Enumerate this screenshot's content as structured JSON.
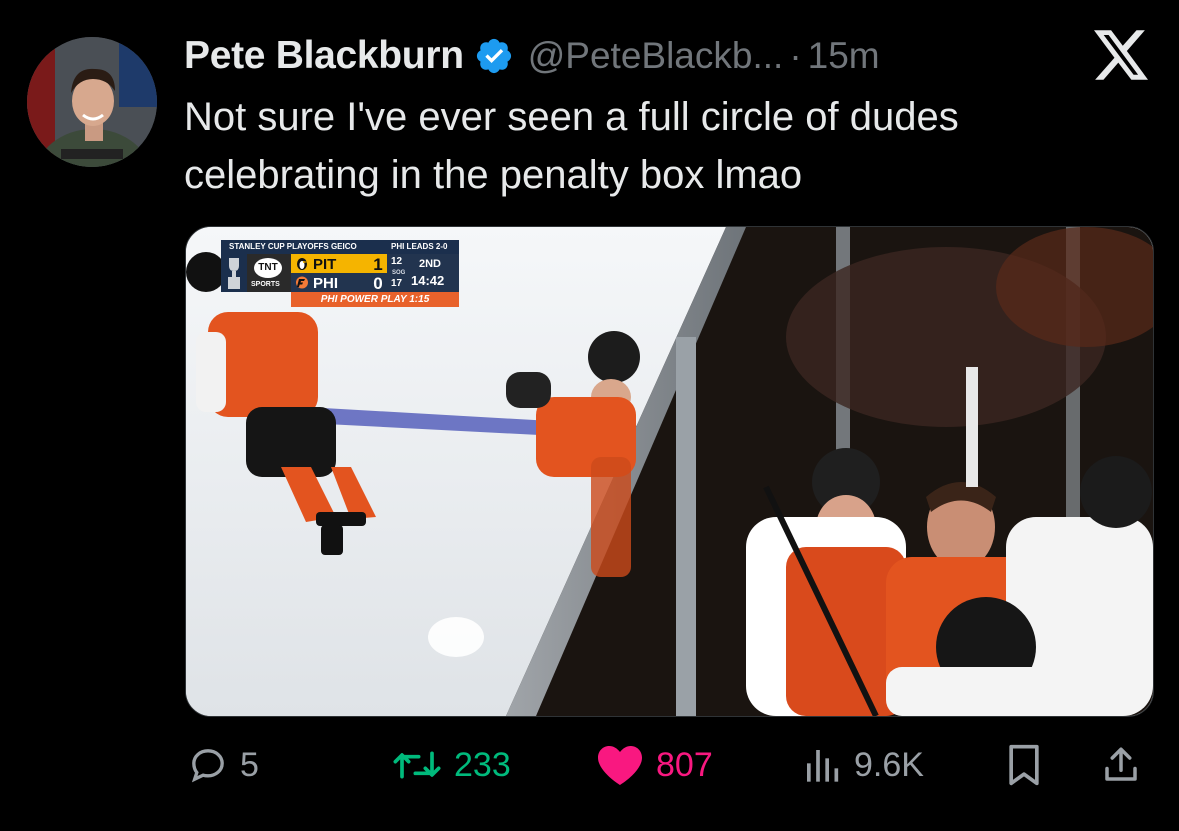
{
  "author": {
    "name": "Pete Blackburn",
    "handle": "@PeteBlackb...",
    "separator": "·",
    "time": "15m",
    "verified": true,
    "avatar_icon": "profile-photo"
  },
  "platform_icon": "x-logo-icon",
  "tweet": {
    "text": "Not sure I've ever seen a full circle of dudes celebrating in the penalty box lmao"
  },
  "media": {
    "scorebug": {
      "header_left": "STANLEY CUP PLAYOFFS GEICO",
      "header_right": "PHI LEADS 2-0",
      "network": "TNT",
      "network_sub": "SPORTS",
      "teams": [
        {
          "abbr": "PIT",
          "score": "1",
          "sog": "12"
        },
        {
          "abbr": "PHI",
          "score": "0",
          "sog": "17"
        }
      ],
      "sog_label": "SOG",
      "period": "2ND",
      "clock": "14:42",
      "power_play": "PHI POWER PLAY 1:15"
    }
  },
  "actions": {
    "replies": "5",
    "retweets": "233",
    "likes": "807",
    "views": "9.6K"
  },
  "colors": {
    "background": "#000000",
    "text": "#e7e9ea",
    "muted": "#71767b",
    "verified": "#1d9bf0",
    "retweet": "#00ba7c",
    "like": "#f91880"
  }
}
